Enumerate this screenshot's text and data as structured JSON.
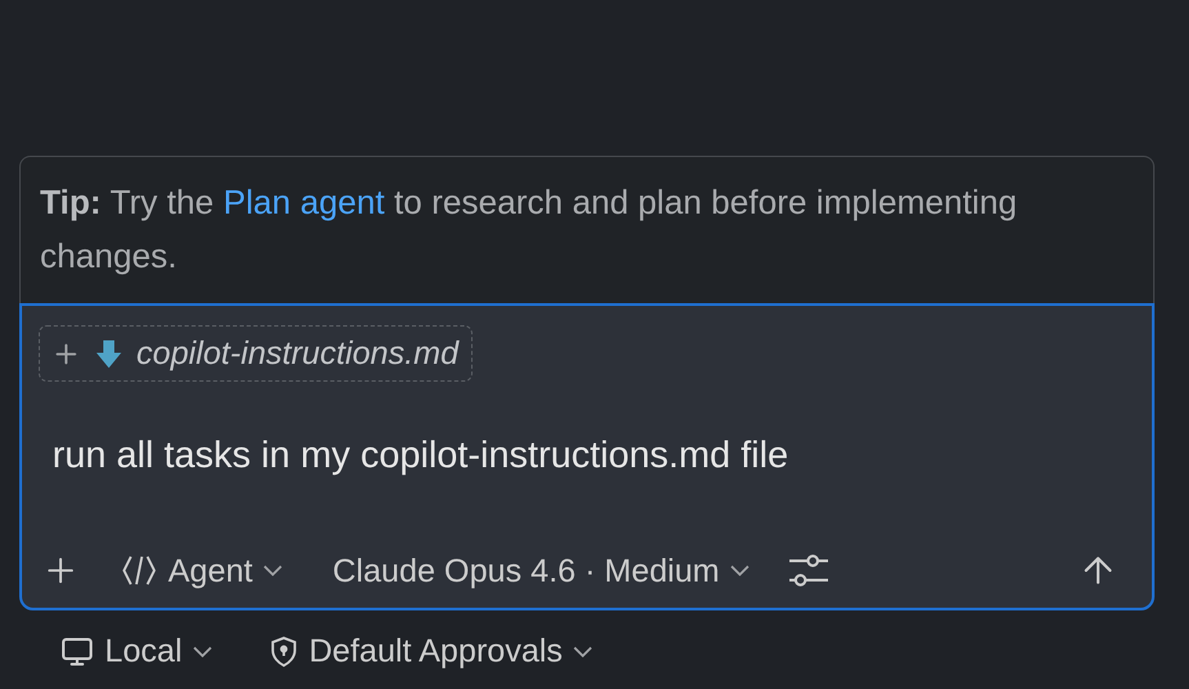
{
  "tip": {
    "label": "Tip:",
    "before": "Try the",
    "link": "Plan agent",
    "after": "to research and plan before implementing changes."
  },
  "attachment": {
    "file": "copilot-instructions.md"
  },
  "prompt": {
    "value": "run all tasks in my copilot-instructions.md file"
  },
  "toolbar": {
    "mode": "Agent",
    "model": "Claude Opus 4.6 · Medium"
  },
  "footer": [
    {
      "kind": "target",
      "label": "Local"
    },
    {
      "kind": "approvals",
      "label": "Default Approvals"
    }
  ]
}
